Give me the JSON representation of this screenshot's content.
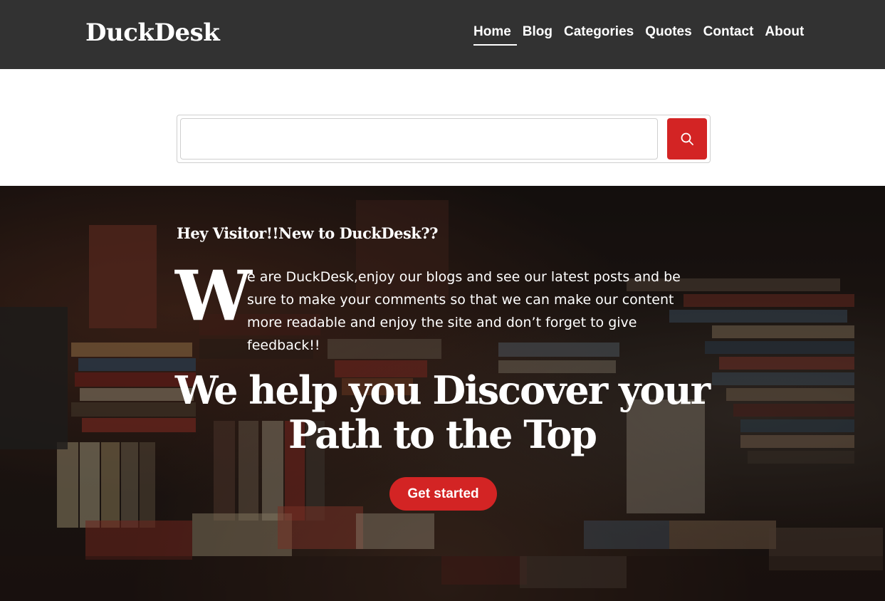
{
  "header": {
    "logo": "DuckDesk",
    "nav": [
      {
        "label": "Home",
        "active": true
      },
      {
        "label": "Blog",
        "active": false
      },
      {
        "label": "Categories",
        "active": false
      },
      {
        "label": "Quotes",
        "active": false
      },
      {
        "label": "Contact",
        "active": false
      },
      {
        "label": "About",
        "active": false
      }
    ]
  },
  "search": {
    "value": "",
    "placeholder": "",
    "button_icon": "search-icon"
  },
  "hero": {
    "heading": "Hey Visitor!!New to DuckDesk??",
    "dropcap": "W",
    "body": "e are DuckDesk,enjoy our blogs and see our latest posts and be sure to make your comments so that we can make our content more readable and enjoy the site and don’t forget to give feedback!!",
    "title_line1": "We help you Discover your",
    "title_line2": "Path to the Top",
    "cta_label": "Get started"
  },
  "colors": {
    "header_bg": "#323232",
    "accent": "#d32424",
    "text_light": "#ffffff"
  }
}
